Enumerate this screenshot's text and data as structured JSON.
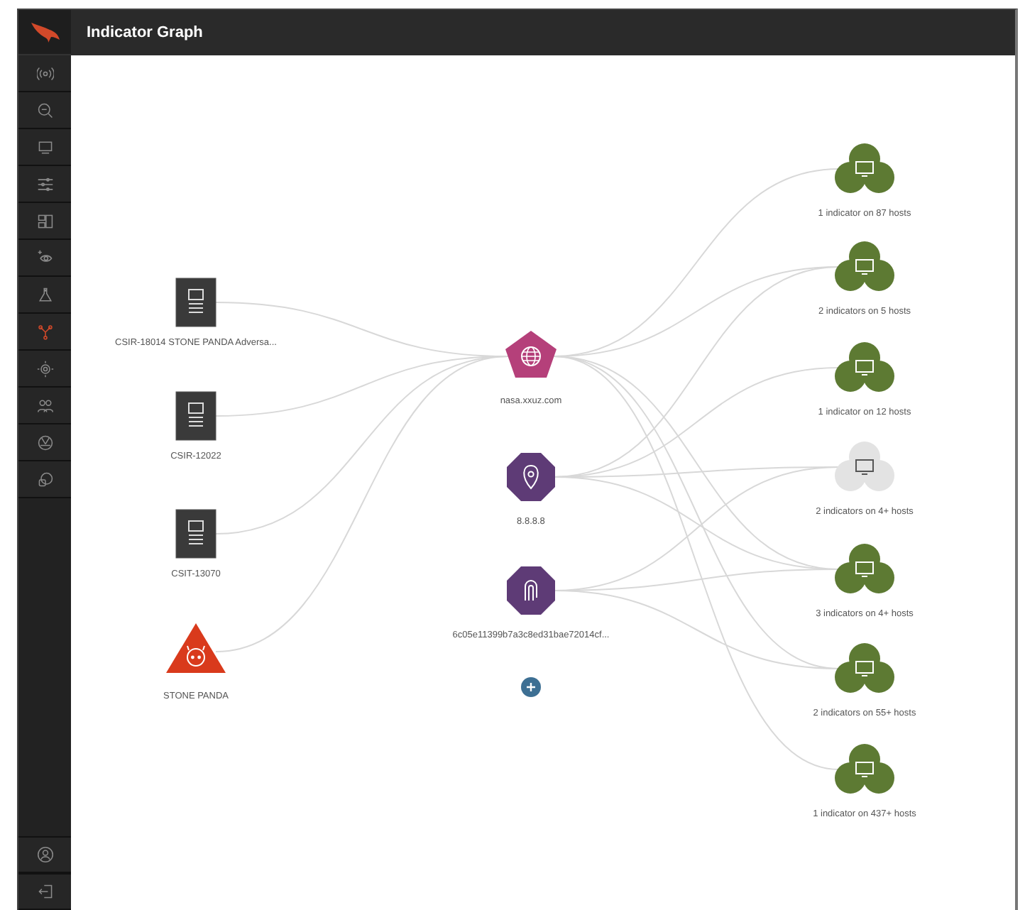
{
  "header": {
    "title": "Indicator Graph"
  },
  "sidebar": {
    "items": [
      {
        "kind": "signal",
        "selected": false
      },
      {
        "kind": "search",
        "selected": false
      },
      {
        "kind": "monitor",
        "selected": false
      },
      {
        "kind": "sliders",
        "selected": false
      },
      {
        "kind": "dashboard",
        "selected": false
      },
      {
        "kind": "eye",
        "selected": false
      },
      {
        "kind": "flask",
        "selected": false
      },
      {
        "kind": "graph",
        "selected": true
      },
      {
        "kind": "target",
        "selected": false
      },
      {
        "kind": "users",
        "selected": false
      },
      {
        "kind": "aperture",
        "selected": false
      },
      {
        "kind": "chat",
        "selected": false
      }
    ],
    "bottom_items": [
      {
        "kind": "user"
      },
      {
        "kind": "logout"
      }
    ]
  },
  "graph": {
    "sources": [
      {
        "kind": "report",
        "label": "CSIR-18014 STONE PANDA Adversa..."
      },
      {
        "kind": "report",
        "label": "CSIR-12022"
      },
      {
        "kind": "report",
        "label": "CSIT-13070"
      },
      {
        "kind": "actor",
        "label": "STONE PANDA"
      }
    ],
    "indicators": [
      {
        "kind": "domain",
        "label": "nasa.xxuz.com"
      },
      {
        "kind": "ip",
        "label": "8.8.8.8"
      },
      {
        "kind": "hash",
        "label": "6c05e11399b7a3c8ed31bae72014cf..."
      }
    ],
    "hosts": [
      {
        "label": "1 indicator on 87 hosts",
        "dimmed": false
      },
      {
        "label": "2 indicators on 5 hosts",
        "dimmed": false
      },
      {
        "label": "1 indicator on 12 hosts",
        "dimmed": false
      },
      {
        "label": "2 indicators on 4+ hosts",
        "dimmed": true
      },
      {
        "label": "3 indicators on 4+ hosts",
        "dimmed": false
      },
      {
        "label": "2 indicators on 55+ hosts",
        "dimmed": false
      },
      {
        "label": "1 indicator on 437+ hosts",
        "dimmed": false
      }
    ]
  }
}
